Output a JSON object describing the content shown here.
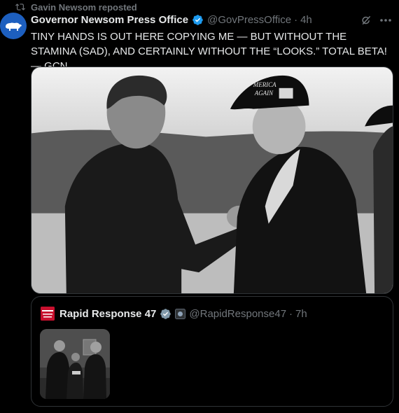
{
  "repost": {
    "text": "Gavin Newsom reposted",
    "icon": "repost-icon"
  },
  "post": {
    "author_name": "Governor Newsom Press Office",
    "handle": "@GovPressOffice",
    "separator": "·",
    "time": "4h",
    "text": "TINY HANDS IS OUT HERE COPYING ME — BUT WITHOUT THE STAMINA (SAD), AND CERTAINLY WITHOUT THE “LOOKS.” TOTAL BETA! — GCN",
    "photo": {
      "hat_text_line1": "MERICA",
      "hat_text_line2": "AGAIN"
    }
  },
  "quote": {
    "author_name": "Rapid Response 47",
    "handle": "@RapidResponse47",
    "separator": "·",
    "time": "7h"
  },
  "colors": {
    "background": "#000000",
    "text_primary": "#e7e9ea",
    "text_secondary": "#71767b",
    "verified_blue": "#1d9bf0",
    "verified_gray": "#829aab",
    "border": "#2f3336"
  },
  "icons": [
    "repost-icon",
    "avatar-bear-icon",
    "verified-badge-icon",
    "grok-icon",
    "more-icon",
    "government-badge-icon"
  ]
}
